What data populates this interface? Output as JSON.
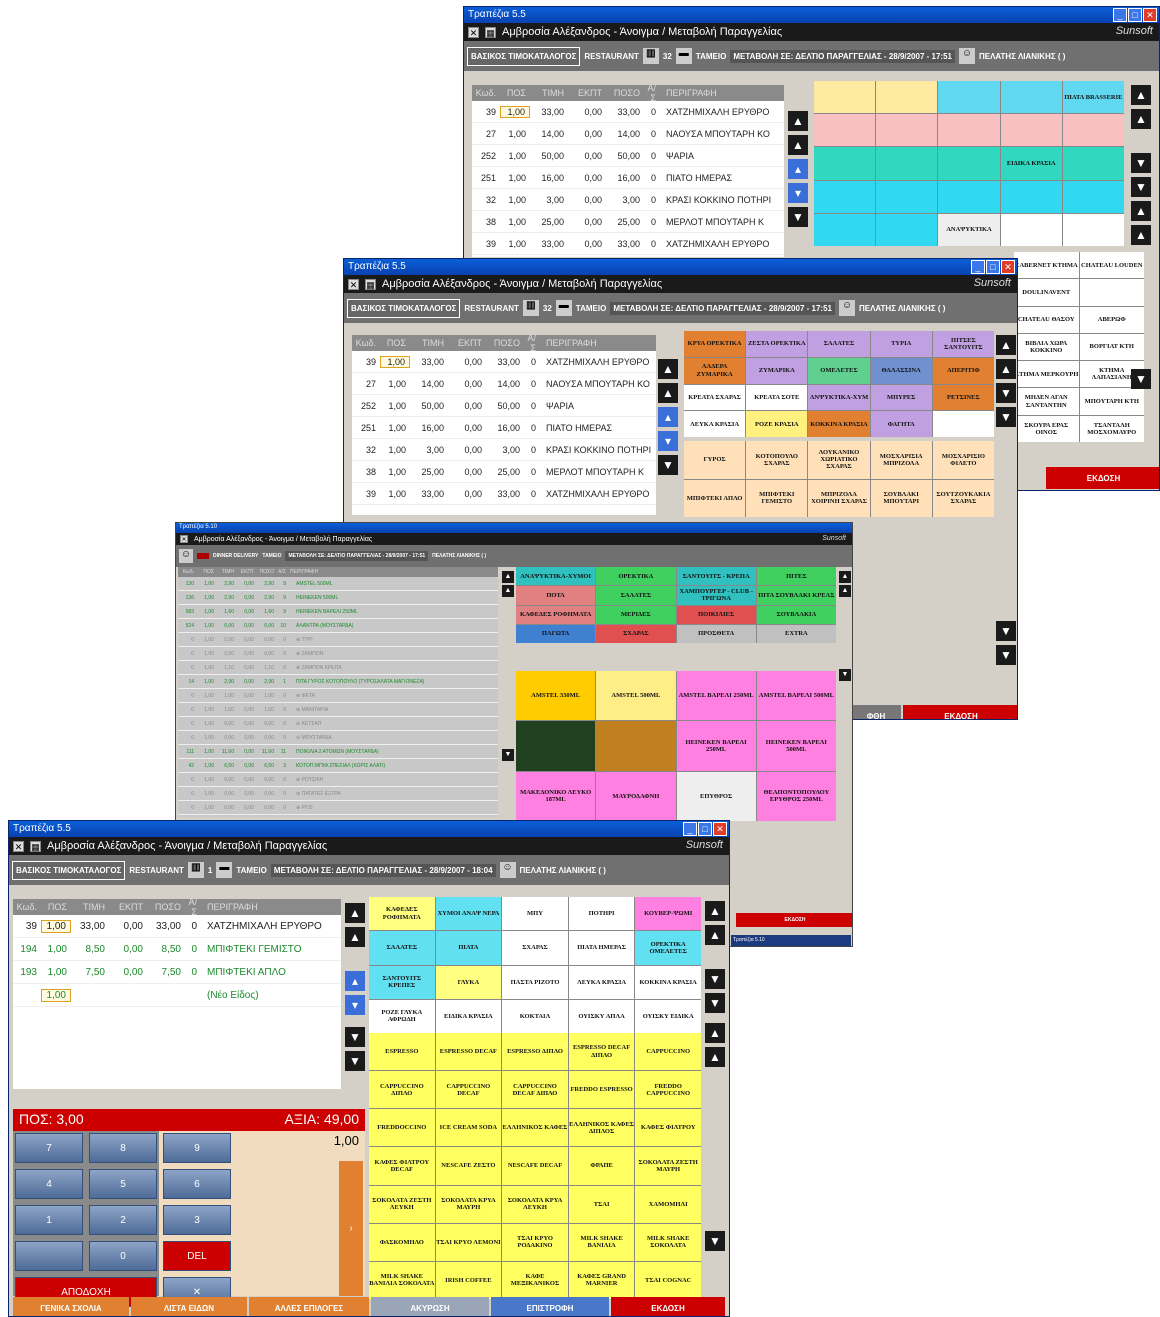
{
  "title": "Τραπέζια 5.5",
  "window_title": "Αμβροσία Αλέξανδρος - Άνοιγμα / Μεταβολή Παραγγελίας",
  "brand": "Sunsoft",
  "info": {
    "catalog": "ΒΑΣΙΚΟΣ ΤΙΜΟΚΑΤΑΛΟΓΟΣ",
    "restaurant": "RESTAURANT",
    "table_no": "32",
    "table_no_front": "1",
    "cashier": "ΤΑΜΕΙΟ",
    "change": "ΜΕΤΑΒΟΛΗ ΣΕ: ΔΕΛΤΙΟ ΠΑΡΑΓΓΕΛΙΑΣ - 28/9/2007 - 17:51",
    "change_front": "ΜΕΤΑΒΟΛΗ ΣΕ: ΔΕΛΤΙΟ ΠΑΡΑΓΓΕΛΙΑΣ - 28/9/2007 - 18:04",
    "customer": "ΠΕΛΑΤΗΣ ΛΙΑΝΙΚΗΣ ( )"
  },
  "columns": [
    "Κωδ.",
    "ΠΟΣ",
    "ΤΙΜΗ",
    "ΕΚΠΤ",
    "ΠΟΣΟ",
    "Α/Σ",
    "ΠΕΡΙΓΡΑΦΗ"
  ],
  "rows_back": [
    [
      "39",
      "1,00",
      "33,00",
      "0,00",
      "33,00",
      "0",
      "ΧΑΤΖΗΜΙΧΑΛΗ ΕΡΥΘΡΟ"
    ],
    [
      "27",
      "1,00",
      "14,00",
      "0,00",
      "14,00",
      "0",
      "ΝΑΟΥΣΑ ΜΠΟΥΤΑΡΗ ΚΟ"
    ],
    [
      "252",
      "1,00",
      "50,00",
      "0,00",
      "50,00",
      "0",
      "ΨΑΡΙΑ"
    ],
    [
      "251",
      "1,00",
      "16,00",
      "0,00",
      "16,00",
      "0",
      "ΠΙΑΤΟ ΗΜΕΡΑΣ"
    ],
    [
      "32",
      "1,00",
      "3,00",
      "0,00",
      "3,00",
      "0",
      "ΚΡΑΣΙ ΚΟΚΚΙΝΟ ΠΟΤΗΡΙ"
    ],
    [
      "38",
      "1,00",
      "25,00",
      "0,00",
      "25,00",
      "0",
      "ΜΕΡΛΟΤ ΜΠΟΥΤΑΡΗ Κ"
    ],
    [
      "39",
      "1,00",
      "33,00",
      "0,00",
      "33,00",
      "0",
      "ΧΑΤΖΗΜΙΧΑΛΗ ΕΡΥΘΡΟ"
    ]
  ],
  "rows_front": [
    [
      "39",
      "1,00",
      "33,00",
      "0,00",
      "33,00",
      "0",
      "ΧΑΤΖΗΜΙΧΑΛΗ ΕΡΥΘΡΟ"
    ],
    [
      "194",
      "1,00",
      "8,50",
      "0,00",
      "8,50",
      "0",
      "ΜΠΙΦΤΕΚΙ ΓΕΜΙΣΤΟ"
    ],
    [
      "193",
      "1,00",
      "7,50",
      "0,00",
      "7,50",
      "0",
      "ΜΠΙΦΤΕΚΙ ΑΠΛΟ"
    ],
    [
      "",
      "1,00",
      "",
      "",
      "",
      "",
      "(Νέο Είδος)"
    ]
  ],
  "cats_w2": [
    "ΚΡΥΑ ΟΡΕΚΤΙΚΑ",
    "ΖΕΣΤΑ ΟΡΕΚΤΙΚΑ",
    "ΣΑΛΑΤΕΣ",
    "ΤΥΡΙΑ",
    "ΠΙΤΣΕΣ ΣΑΝΤΟΥΙΤΣ",
    "ΛΑΔΕΡΑ ΖΥΜΑΡΙΚΑ",
    "ΖΥΜΑΡΙΚΑ",
    "ΟΜΕΛΕΤΕΣ",
    "ΘΑΛΑΣΣΙΝΑ",
    "ΑΠΕΡΙΤΙΦ",
    "ΚΡΕΑΤΑ ΣΧΑΡΑΣ",
    "ΚΡΕΑΤΑ ΣΟΤΕ",
    "ΑΝΨΥΚΤΙΚΑ-ΧΥΜ",
    "ΜΠΥΡΕΣ",
    "ΡΕΤΣΙΝΕΣ",
    "ΛΕΥΚΑ ΚΡΑΣΙΑ",
    "ΡΟΖΕ ΚΡΑΣΙΑ",
    "ΚΟΚΚΙΝΑ ΚΡΑΣΙΑ",
    "ΦΑΓΗΤΑ",
    ""
  ],
  "items_w2": [
    "ΓΥΡΟΣ",
    "ΚΟΤΟΠΟΥΛΟ ΣΧΑΡΑΣ",
    "ΛΟΥΚΑΝΙΚΟ ΧΩΡΙΑΤΙΚΟ ΣΧΑΡΑΣ",
    "ΜΟΣΧΑΡΙΣΙΑ ΜΠΡΙΖΟΛΑ",
    "ΜΟΣΧΑΡΙΣΙΟ ΦΙΛΕΤΟ",
    "ΜΠΙΦΤΕΚΙ ΑΠΛΟ",
    "ΜΠΙΦΤΕΚΙ ΓΕΜΙΣΤΟ",
    "ΜΠΡΙΖΟΛΑ ΧΟΙΡΙΝΗ ΣΧΑΡΑΣ",
    "ΣΟΥΒΛΑΚΙ ΜΠΟΥΤΑΡΙ",
    "ΣΟΥΤΖΟΥΚΑΚΙΑ ΣΧΑΡΑΣ"
  ],
  "wines_w1": [
    "CABERNET ΚΤΗΜΑ",
    "CHATEAU LOUDEN",
    "DOULINAVENT",
    "",
    "CHATEAU ΘΑΣΟΥ",
    "ΑΒΕΡΩΦ",
    "ΒΙΒΛΙΑ ΧΩΡΑ ΚΟΚΚΙΝΟ",
    "ΒΟΡΓΙΑΤ ΚΤΗ",
    "ΚΤΗΜΑ ΜΕΡΚΟΥΡΗ",
    "ΚΤΗΜΑ ΛΑΠΑΣΙΑΝΗ",
    "ΜΗΔΕΝ ΑΓΑΝ ΣΑΝΤΑΝΤΗΝ",
    "ΜΠΟΥΤΑΡΗ ΚΤΗ",
    "ΣΚΟΥΡΑ ΕΡΑΣ ΟΙΝΟΣ",
    "ΤΣΑΝΤΑΛΗ ΜΟΣΧΟΜΑΥΡΟ"
  ],
  "sidebar_w1": [
    "",
    "",
    "",
    "",
    "ΠΙΑΤΑ BRASSERIE",
    "",
    "",
    "",
    "",
    "",
    "",
    "",
    "",
    "ΕΙΔΙΚΑ ΚΡΑΣΙΑ",
    "",
    "",
    "",
    "",
    "",
    "",
    "",
    "",
    "ΑΝΑΨΥΚΤΙΚΑ",
    "",
    ""
  ],
  "w3": {
    "title": "Τραπέζια 5.10",
    "window_title": "Αμβροσία Αλέξανδρος - Άνοιγμα / Μεταβολή Παραγγελίας",
    "mode": "DINNER DELIVERY",
    "customer": "ΠΕΛΑΤΗΣ ΛΙΑΝΙΚΗΣ ( )",
    "cats": [
      "ΑΝΑΨΥΚΤΙΚΑ-ΧΥΜΟΙ",
      "ΟΡΕΚΤΙΚΑ",
      "ΣΑΝΤΟΥΙΤΣ - ΚΡΕΠΑ",
      "ΠΙΤΕΣ",
      "ΠΟΤΑ",
      "ΣΑΛΑΤΕΣ",
      "ΧΑΜΠΟΥΡΓΕΡ - CLUB - ΤΡΙΓΩΝΑ",
      "ΠΙΤΑ ΣΟΥΒΛΑΚΙ ΚΡΕΑΣ",
      "ΚΑΦΕΔΕΣ ΡΟΦΗΜΑΤΑ",
      "ΜΕΡΙΔΕΣ",
      "ΠΟΙΚΙΛΙΕΣ",
      "ΣΟΥΒΛΑΚΙΑ",
      "ΠΑΓΩΤΑ",
      "ΣΧΑΡΑΣ",
      "ΠΡΟΣΘΕΤΑ",
      "EXTRA"
    ],
    "items": [
      "AMSTEL 330ML",
      "AMSTEL 500ML",
      "AMSTEL ΒΑΡΕΛΙ 250ML",
      "AMSTEL ΒΑΡΕΛΙ 500ML",
      "",
      "",
      "HEINEKEN ΒΑΡΕΛΙ 250ML",
      "HEINEKEN ΒΑΡΕΛΙ 500ML",
      "ΜΑΚΕΔΟΝΙΚΟ ΛΕΥΚΟ 187ML",
      "ΜΑΥΡΟΔΑΦΝΗ",
      "ΕΠΥΘΡΟΣ",
      "ΘΕΑΠΟΝΤΟΠΟΥΛΟΥ ΕΡΥΘΡΟΣ 250ML"
    ],
    "rows": [
      [
        "130",
        "1,00",
        "2,90",
        "0,00",
        "2,90",
        "9",
        "AMSTEL 500ML"
      ],
      [
        "136",
        "1,00",
        "2,90",
        "0,00",
        "2,90",
        "9",
        "HEINEKEN 500ML"
      ],
      [
        "583",
        "1,00",
        "1,60",
        "0,00",
        "1,60",
        "9",
        "HEINEKEN ΒΑΡΕΛΙ 250ML"
      ],
      [
        "524",
        "1,00",
        "6,00",
        "0,00",
        "6,00",
        "10",
        "ΑΛΑΝΤΡΑ (ΜΟΥΣΤΑΡΔΑ)"
      ],
      [
        "0",
        "1,00",
        "0,50",
        "0,00",
        "0,00",
        "0",
        "⊕ ΤΥΡΙ"
      ],
      [
        "0",
        "1,00",
        "0,50",
        "0,00",
        "0,00",
        "0",
        "⊕ ΖΑΜΠΟΝ"
      ],
      [
        "0",
        "1,00",
        "1,10",
        "0,00",
        "1,10",
        "0",
        "⊕ ΖΑΜΠΟΝ ΚΡΕΠΑ"
      ],
      [
        "14",
        "1,00",
        "2,90",
        "0,00",
        "2,90",
        "1",
        "ΠΙΤΑ ΓΥΡΟΣ ΚΟΤΟΠΟΥΛΟ (ΤΥΡΟΣΑΛΑΤΑ ΜΑΓΙΟΝΕΖΑ)"
      ],
      [
        "0",
        "1,00",
        "1,00",
        "0,00",
        "1,00",
        "0",
        "⊕ ΦΕΤΑ"
      ],
      [
        "0",
        "1,00",
        "1,00",
        "0,00",
        "1,00",
        "0",
        "⊕ ΜΑΝΙΤΑΡΙΑ"
      ],
      [
        "0",
        "1,00",
        "0,00",
        "0,00",
        "0,00",
        "0",
        "⊖ ΚΕΤΣΑΠ"
      ],
      [
        "0",
        "1,00",
        "0,00",
        "0,00",
        "0,00",
        "0",
        "⊖ ΜΟΥΣΤΑΡΔΑ"
      ],
      [
        "111",
        "1,00",
        "11,60",
        "0,00",
        "11,60",
        "11",
        "ΠΟΙΚΙΛΙΑ 2 ΑΤΟΜΩΝ (ΜΟΥΣΤΑΡΔΑ)"
      ],
      [
        "42",
        "1,00",
        "6,50",
        "0,00",
        "6,50",
        "3",
        "ΚΟΤΟΠ.ΜΠΙΦ.ΣΠΕΣΙΑΛ (ΧΩΡΙΣ ΑΛΑΤΙ)"
      ],
      [
        "0",
        "1,00",
        "0,00",
        "0,00",
        "0,00",
        "0",
        "⊕ ΡΟΥΣΙΚΗ"
      ],
      [
        "0",
        "1,00",
        "0,00",
        "0,00",
        "0,00",
        "0",
        "⊕ ΠΑΤΑΤΕΣ ΕΞΤΡΑ"
      ],
      [
        "0",
        "1,00",
        "0,00",
        "0,00",
        "0,00",
        "0",
        "⊕ ΡΥΖΙ"
      ]
    ],
    "bottom": "ΕΚΔΟΣΗ",
    "task": "Τραπέζια 5.10"
  },
  "w1_bottom": [
    "ΕΚΔΟΣΗ"
  ],
  "w2_bottom": [
    "ΦΘΗ",
    "ΕΚΔΟΣΗ"
  ],
  "front": {
    "pos_label": "ΠΟΣ: 3,00",
    "value_label": "ΑΞΙΑ: 49,00",
    "display": "1,00",
    "keys": [
      "7",
      "8",
      "9",
      "4",
      "5",
      "6",
      "1",
      "2",
      "3",
      "",
      "0",
      "DEL",
      "ΑΠΟΔΟΧΗ",
      "",
      ""
    ],
    "items": [
      "ΚΑΦΕΔΕΣ ΡΟΦΗΜΑΤΑ",
      "ΧΥΜΟΙ ΑΝΑΨ ΝΕΡΑ",
      "ΜΠΥ",
      "ΠΟΤΗΡΙ",
      "ΚΟΥΒΕΡ-ΨΩΜΙ",
      "ΣΑΛΑΤΕΣ",
      "ΠΙΑΤΑ",
      "ΣΧΑΡΑΣ",
      "ΠΙΑΤΑ ΗΜΕΡΑΣ",
      "ΟΡΕΚΤΙΚΑ ΟΜΕΛΕΤΕΣ",
      "ΣΑΝΤΟΥΙΤΣ ΚΡΕΠΕΣ",
      "ΓΛΥΚΑ",
      "ΠΑΣΤΑ ΡΙΖΟΤΟ",
      "ΛΕΥΚΑ ΚΡΑΣΙΑ",
      "ΚΟΚΚΙΝΑ ΚΡΑΣΙΑ",
      "ΡΟΖΕ ΓΛΥΚΑ ΑΦΡΩΔΗ",
      "ΕΙΔΙΚΑ ΚΡΑΣΙΑ",
      "ΚΟΚΤΑΙΛ",
      "ΟΥΙΣΚΥ ΑΠΛΑ",
      "ΟΥΙΣΚΥ ΕΙΔΙΚΑ"
    ],
    "coffees": [
      "ESPRESSO",
      "ESPRESSO DECAF",
      "ESPRESSO ΔΙΠΛΟ",
      "ESPRESSO DECAF ΔΙΠΛΟ",
      "CAPPUCCINO",
      "CAPPUCCINO ΔΙΠΛΟ",
      "CAPPUCCINO DECAF",
      "CAPPUCCINO DECAF ΔΙΠΛΟ",
      "FREDDO ESPRESSO",
      "FREDDO CAPPUCCINO",
      "FREDDOCCINO",
      "ICE CREAM SODA",
      "ΕΛΛΗΝΙΚΟΣ ΚΑΦΕΣ",
      "ΕΛΛΗΝΙΚΟΣ ΚΑΦΕΣ ΔΙΠΛΟΣ",
      "ΚΑΦΕΣ ΦΙΛΤΡΟΥ",
      "ΚΑΦΕΣ ΦΙΛΤΡΟΥ DECAF",
      "NESCAFE ΖΕΣΤΟ",
      "NESCAFE DECAF",
      "ΦΡΑΠΕ",
      "ΣΟΚΟΛΑΤΑ ΖΕΣΤΗ ΜΑΥΡΗ",
      "ΣΟΚΟΛΑΤΑ ΖΕΣΤΗ ΛΕΥΚΗ",
      "ΣΟΚΟΛΑΤΑ ΚΡΥΑ ΜΑΥΡΗ",
      "ΣΟΚΟΛΑΤΑ ΚΡΥΑ ΛΕΥΚΗ",
      "ΤΣΑΙ",
      "ΧΑΜΟΜΗΛΙ",
      "ΦΑΣΚΟΜΗΛΟ",
      "ΤΣΑΙ ΚΡΥΟ ΛΕΜΟΝΙ",
      "ΤΣΑΙ ΚΡΥΟ ΡΟΔΑΚΙΝΟ",
      "MILK SHAKE ΒΑΝΙΛΙΑ",
      "MILK SHAKE ΣΟΚΟΛΑΤΑ",
      "MILK SHAKE ΒΑΝΙΛΙΑ ΣΟΚΟΛΑΤΑ",
      "IRISH COFFEE",
      "ΚΑΦΕ ΜΕΞΙΚΑΝΙΚΟΣ",
      "ΚΑΦΕΣ GRAND MARNIER",
      "ΤΣΑΙ COGNAC"
    ],
    "bottom": [
      "ΓΕΝΙΚΑ ΣΧΟΛΙΑ",
      "ΛΙΣΤΑ ΕΙΔΩΝ",
      "ΑΛΛΕΣ ΕΠΙΛΟΓΕΣ",
      "ΑΚΥΡΩΣΗ",
      "ΕΠΙΣΤΡΟΦΗ",
      "ΕΚΔΟΣΗ"
    ]
  }
}
